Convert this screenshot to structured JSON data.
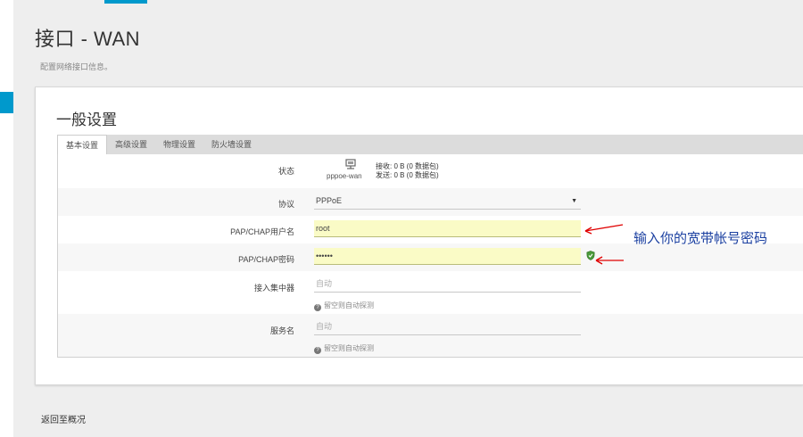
{
  "header": {
    "title": "接口 - WAN",
    "description": "配置网络接口信息。"
  },
  "section": {
    "title": "一般设置"
  },
  "tabs": [
    {
      "label": "基本设置",
      "active": true
    },
    {
      "label": "高级设置",
      "active": false
    },
    {
      "label": "物理设置",
      "active": false
    },
    {
      "label": "防火墙设置",
      "active": false
    }
  ],
  "status": {
    "label": "状态",
    "iface_name": "pppoe-wan",
    "rx": "接收: 0 B (0 数据包)",
    "tx": "发送: 0 B (0 数据包)"
  },
  "protocol": {
    "label": "协议",
    "value": "PPPoE"
  },
  "username": {
    "label": "PAP/CHAP用户名",
    "value": "root"
  },
  "password": {
    "label": "PAP/CHAP密码",
    "value": "••••••"
  },
  "concentrator": {
    "label": "接入集中器",
    "placeholder": "自动",
    "hint": "留空则自动探测"
  },
  "service": {
    "label": "服务名",
    "placeholder": "自动",
    "hint": "留空则自动探测"
  },
  "annotation": {
    "text": "输入你的宽带帐号密码"
  },
  "footer": {
    "back_label": "返回至概况"
  },
  "colors": {
    "accent": "#0099cc",
    "highlight": "#fafbc6",
    "annotation": "#1a3fa0",
    "arrow": "#e00000"
  }
}
